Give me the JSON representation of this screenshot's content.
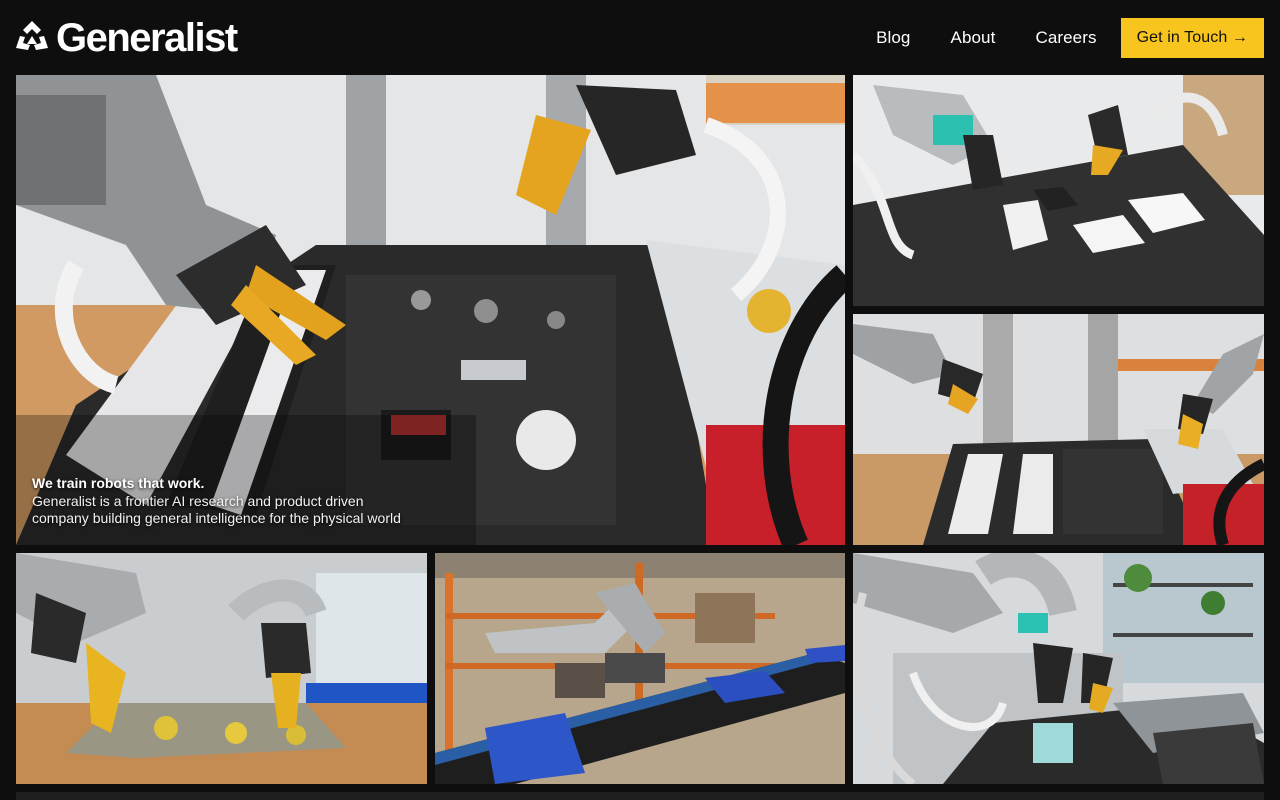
{
  "brand": {
    "name": "Generalist",
    "logo_icon": "triskelion-logo-icon"
  },
  "nav": {
    "links": [
      "Blog",
      "About",
      "Careers"
    ],
    "cta": "Get in Touch →"
  },
  "hero": {
    "tagline": "We train robots that work.",
    "description_line1": "Generalist is a frontier AI research and product driven",
    "description_line2": "company building general intelligence for the physical world"
  },
  "colors": {
    "accent": "#f7c51e",
    "background": "#0e0e0e"
  }
}
